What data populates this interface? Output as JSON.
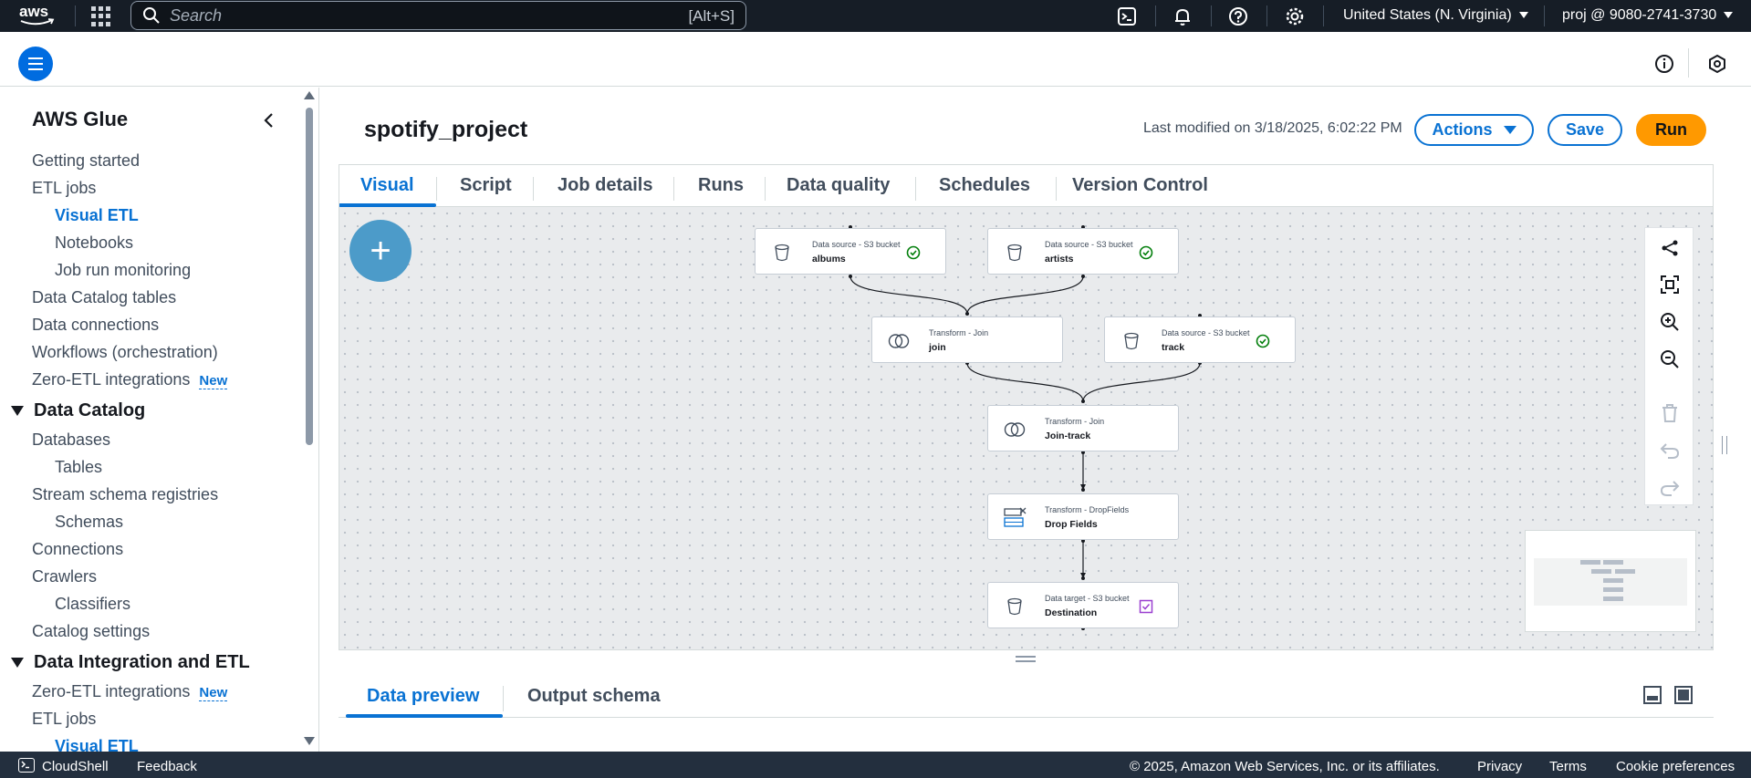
{
  "topnav": {
    "logo": "aws",
    "search_placeholder": "Search",
    "search_shortcut": "[Alt+S]",
    "region": "United States (N. Virginia)",
    "account": "proj @ 9080-2741-3730",
    "icons": [
      "apps-grid-icon",
      "search-icon",
      "cloudshell-icon",
      "bell-icon",
      "help-icon",
      "settings-icon"
    ]
  },
  "sidebar": {
    "title": "AWS Glue",
    "items": [
      {
        "label": "Getting started"
      },
      {
        "label": "ETL jobs"
      },
      {
        "label": "Visual ETL"
      },
      {
        "label": "Notebooks"
      },
      {
        "label": "Job run monitoring"
      },
      {
        "label": "Data Catalog tables"
      },
      {
        "label": "Data connections"
      },
      {
        "label": "Workflows (orchestration)"
      },
      {
        "label": "Zero-ETL integrations",
        "badge": "New"
      },
      {
        "label": "Data Catalog"
      },
      {
        "label": "Databases"
      },
      {
        "label": "Tables"
      },
      {
        "label": "Stream schema registries"
      },
      {
        "label": "Schemas"
      },
      {
        "label": "Connections"
      },
      {
        "label": "Crawlers"
      },
      {
        "label": "Classifiers"
      },
      {
        "label": "Catalog settings"
      },
      {
        "label": "Data Integration and ETL"
      },
      {
        "label": "Zero-ETL integrations",
        "badge": "New"
      },
      {
        "label": "ETL jobs"
      },
      {
        "label": "Visual ETL"
      }
    ]
  },
  "job": {
    "title": "spotify_project",
    "last_modified": "Last modified on 3/18/2025, 6:02:22 PM",
    "actions_label": "Actions",
    "save_label": "Save",
    "run_label": "Run"
  },
  "tabs": [
    "Visual",
    "Script",
    "Job details",
    "Runs",
    "Data quality",
    "Schedules",
    "Version Control"
  ],
  "nodes": [
    {
      "type": "Data source - S3 bucket",
      "name": "albums",
      "icon": "bucket-icon",
      "status": "check-circle-icon"
    },
    {
      "type": "Data source - S3 bucket",
      "name": "artists",
      "icon": "bucket-icon",
      "status": "check-circle-icon"
    },
    {
      "type": "Transform - Join",
      "name": "join",
      "icon": "join-icon",
      "status": ""
    },
    {
      "type": "Data source - S3 bucket",
      "name": "track",
      "icon": "bucket-icon",
      "status": "check-circle-icon"
    },
    {
      "type": "Transform - Join",
      "name": "Join-track",
      "icon": "join-icon",
      "status": ""
    },
    {
      "type": "Transform - DropFields",
      "name": "Drop Fields",
      "icon": "drop-fields-icon",
      "status": ""
    },
    {
      "type": "Data target - S3 bucket",
      "name": "Destination",
      "icon": "bucket-icon",
      "status": "target-check-icon"
    }
  ],
  "bottom_tabs": [
    "Data preview",
    "Output schema"
  ],
  "footer": {
    "cloudshell": "CloudShell",
    "feedback": "Feedback",
    "copyright": "© 2025, Amazon Web Services, Inc. or its affiliates.",
    "privacy": "Privacy",
    "terms": "Terms",
    "cookies": "Cookie preferences"
  },
  "colors": {
    "nav_bg": "#161d26",
    "accent": "#0972d3",
    "run_button": "#ff9900",
    "canvas_bg": "#e9ebed",
    "success": "#037f0c",
    "target": "#9a3fd0"
  }
}
